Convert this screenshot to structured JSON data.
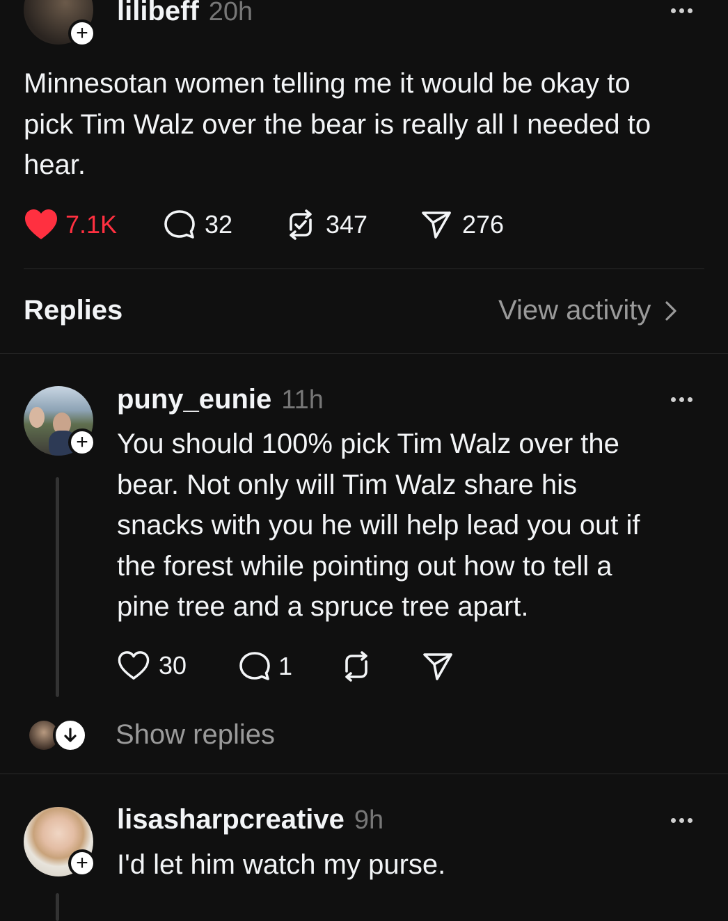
{
  "main_post": {
    "username": "lilibeff",
    "time": "20h",
    "text_lines": [
      "Minnesotan women telling me it would be okay to",
      "pick Tim Walz over the bear is really all I needed to",
      "hear."
    ],
    "likes": "7.1K",
    "replies": "32",
    "reposts": "347",
    "shares": "276",
    "like_color": "#ff3040"
  },
  "replies_header": {
    "title": "Replies",
    "view_activity": "View activity"
  },
  "reply1": {
    "username": "puny_eunie",
    "time": "11h",
    "text_lines": [
      "You should 100% pick Tim Walz over the",
      "bear. Not only will Tim Walz share his",
      "snacks with you he will help lead you out if",
      "the forest while pointing out how to tell a",
      "pine tree and a spruce tree apart."
    ],
    "likes": "30",
    "replies": "1",
    "show_replies": "Show replies"
  },
  "reply2": {
    "username": "lisasharpcreative",
    "time": "9h",
    "text_lines": [
      "I'd let him watch my purse."
    ]
  }
}
